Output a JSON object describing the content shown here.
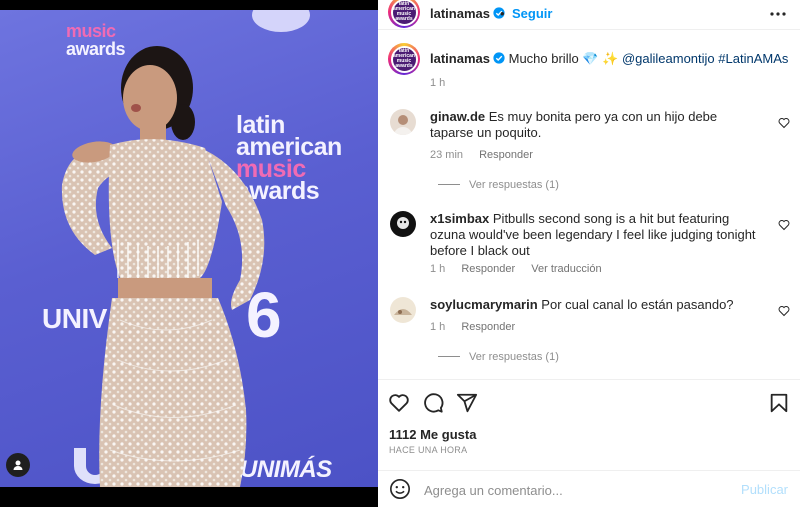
{
  "media": {
    "wall": {
      "music_awards_line1": "music",
      "music_awards_line2": "awards",
      "latin": "latin",
      "american": "american",
      "music": "music",
      "awards": "awards",
      "univision": "UNIV",
      "unimas": "UNIMÁS",
      "six": "6"
    },
    "colors": {
      "backdrop": "#5a5fd1",
      "pink": "#f06bb4"
    }
  },
  "header": {
    "username": "latinamas",
    "separator": "•",
    "follow_label": "Seguir",
    "avatar_text": [
      "latin",
      "american",
      "music",
      "awards"
    ]
  },
  "caption": {
    "username": "latinamas",
    "text": "Mucho brillo",
    "emojis": "💎 ✨",
    "mention": "@galileamontijo",
    "hashtag": "#LatinAMAs",
    "time": "1 h"
  },
  "comments": [
    {
      "username": "ginaw.de",
      "text": "Es muy bonita pero ya con un hijo debe taparse un poquito.",
      "time": "23 min",
      "reply_label": "Responder",
      "view_replies": "Ver respuestas (1)"
    },
    {
      "username": "x1simbax",
      "text": "Pitbulls second song is a hit but featuring ozuna would've been legendary I feel like judging tonight before I black out",
      "time": "1 h",
      "reply_label": "Responder",
      "translate_label": "Ver traducción"
    },
    {
      "username": "soylucmarymarin",
      "text": "Por cual canal lo están pasando?",
      "time": "1 h",
      "reply_label": "Responder",
      "view_replies": "Ver respuestas (1)"
    }
  ],
  "actions": {
    "likes": "1112 Me gusta",
    "posted": "HACE UNA HORA",
    "icons": [
      "heart-icon",
      "comment-icon",
      "share-icon",
      "bookmark-icon"
    ]
  },
  "composer": {
    "placeholder": "Agrega un comentario...",
    "post_label": "Publicar"
  },
  "theme": {
    "link": "#00376b",
    "blue": "#0095f6",
    "muted": "#8e8e8e",
    "post_disabled": "#b2dffc"
  }
}
